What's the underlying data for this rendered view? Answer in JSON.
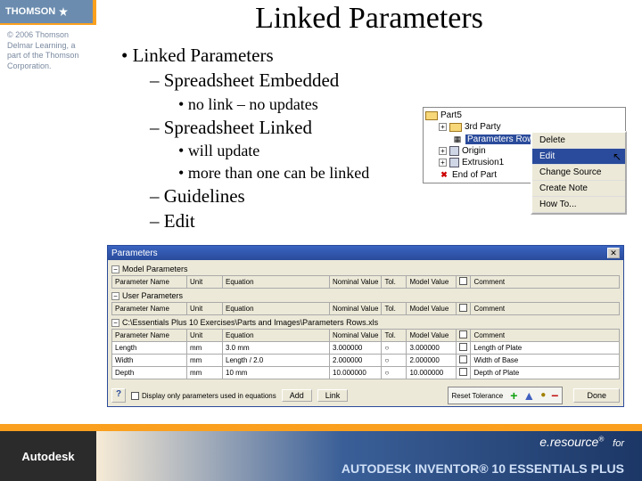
{
  "sidebar": {
    "brand": "THOMSON",
    "copyright": "© 2006 Thomson Delmar Learning, a part of the Thomson Corporation."
  },
  "slide": {
    "title": "Linked Parameters",
    "b1": "Linked Parameters",
    "b2a": "Spreadsheet Embedded",
    "b3a": "no link – no updates",
    "b2b": "Spreadsheet Linked",
    "b3b": "will update",
    "b3c": "more than one can be linked",
    "b2c": "Guidelines",
    "b2d": "Edit"
  },
  "tree": {
    "root": "Part5",
    "items": [
      "3rd Party",
      "Parameters Rows.xls",
      "Origin",
      "Extrusion1",
      "End of Part"
    ]
  },
  "cmenu": {
    "items": [
      "Delete",
      "Edit",
      "Change Source",
      "Create Note",
      "How To..."
    ]
  },
  "params": {
    "title": "Parameters",
    "sec1": "Model Parameters",
    "sec2": "User Parameters",
    "sec3": "C:\\Essentials Plus 10 Exercises\\Parts and Images\\Parameters Rows.xls",
    "cols": {
      "name": "Parameter Name",
      "unit": "Unit",
      "eq": "Equation",
      "nom": "Nominal Value",
      "tol": "Tol.",
      "mv": "Model Value",
      "cmt": "Comment"
    },
    "rows": [
      {
        "name": "Length",
        "unit": "mm",
        "eq": "3.0 mm",
        "nom": "3.000000",
        "tol": "○",
        "mv": "3.000000",
        "cmt": "Length of Plate"
      },
      {
        "name": "Width",
        "unit": "mm",
        "eq": "Length / 2.0",
        "nom": "2.000000",
        "tol": "○",
        "mv": "2.000000",
        "cmt": "Width of Base"
      },
      {
        "name": "Depth",
        "unit": "mm",
        "eq": "10 mm",
        "nom": "10.000000",
        "tol": "○",
        "mv": "10.000000",
        "cmt": "Depth of Plate"
      }
    ],
    "footer": {
      "chk": "Display only parameters used in equations",
      "add": "Add",
      "link": "Link",
      "reset": "Reset Tolerance",
      "done": "Done"
    }
  },
  "bottom": {
    "autodesk": "Autodesk",
    "eresource": "e.resource",
    "for": "for",
    "inventor": "AUTODESK INVENTOR® 10 ESSENTIALS PLUS"
  }
}
